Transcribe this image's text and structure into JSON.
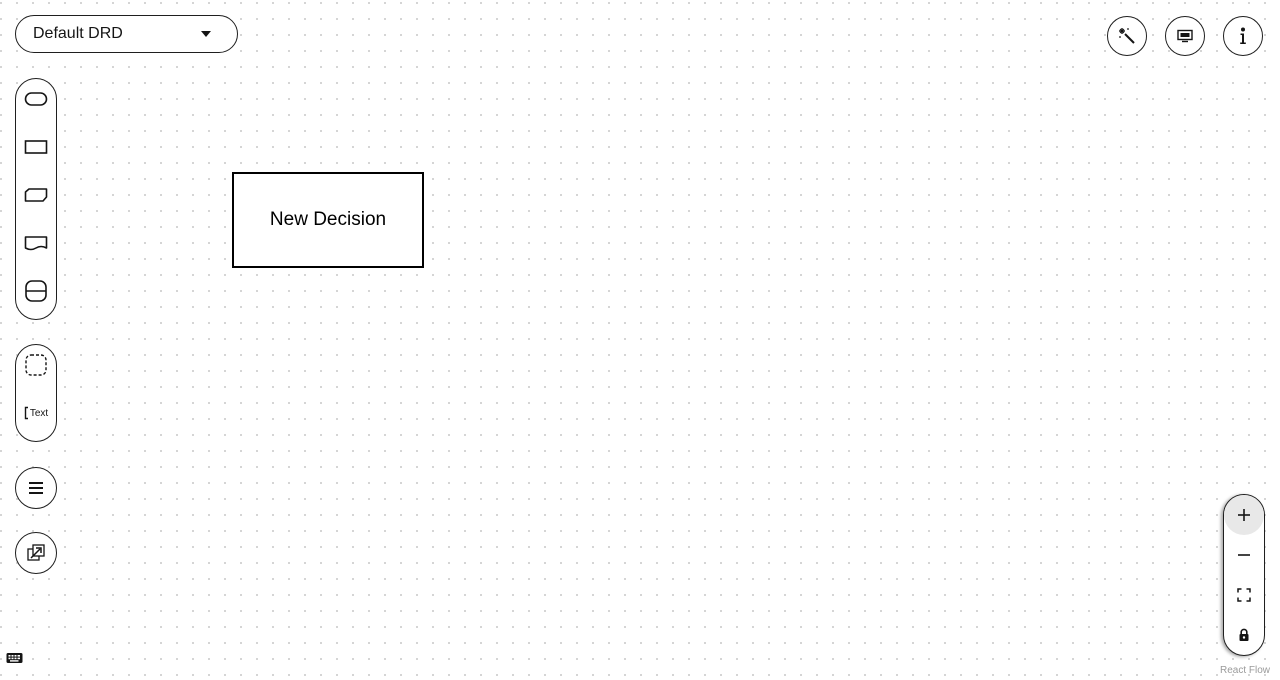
{
  "drd_selector": {
    "selected": "Default DRD",
    "icon": "caret-down-icon"
  },
  "top_right_buttons": [
    {
      "name": "auto-layout-button",
      "icon": "magic-wand-icon"
    },
    {
      "name": "overlays-button",
      "icon": "monitor-icon"
    },
    {
      "name": "properties-button",
      "icon": "info-icon"
    }
  ],
  "node_palette": [
    {
      "name": "input-data",
      "icon": "input-data-icon"
    },
    {
      "name": "decision",
      "icon": "decision-icon"
    },
    {
      "name": "business-knowledge-model",
      "icon": "bkm-icon"
    },
    {
      "name": "knowledge-source",
      "icon": "knowledge-source-icon"
    },
    {
      "name": "decision-service",
      "icon": "decision-service-icon"
    }
  ],
  "artifact_palette": [
    {
      "name": "group",
      "icon": "group-icon"
    },
    {
      "name": "text-annotation",
      "icon": "text-annotation-icon",
      "label": "Text"
    }
  ],
  "side_buttons": [
    {
      "name": "decision-navigator-button",
      "icon": "hamburger-icon"
    },
    {
      "name": "external-models-button",
      "icon": "external-link-icon"
    }
  ],
  "nodes": [
    {
      "type": "decision",
      "label": "New Decision"
    }
  ],
  "zoom_controls": [
    {
      "name": "zoom-in",
      "icon": "plus-icon"
    },
    {
      "name": "zoom-out",
      "icon": "minus-icon"
    },
    {
      "name": "fit-view",
      "icon": "fit-view-icon"
    },
    {
      "name": "toggle-interactivity",
      "icon": "lock-icon"
    }
  ],
  "attribution": "React Flow",
  "colors": {
    "border": "#1f1f1f",
    "dot_grid": "#c9c9c9",
    "attribution_text": "#9a9a9a",
    "active_button_bg": "#e8e8e8"
  }
}
